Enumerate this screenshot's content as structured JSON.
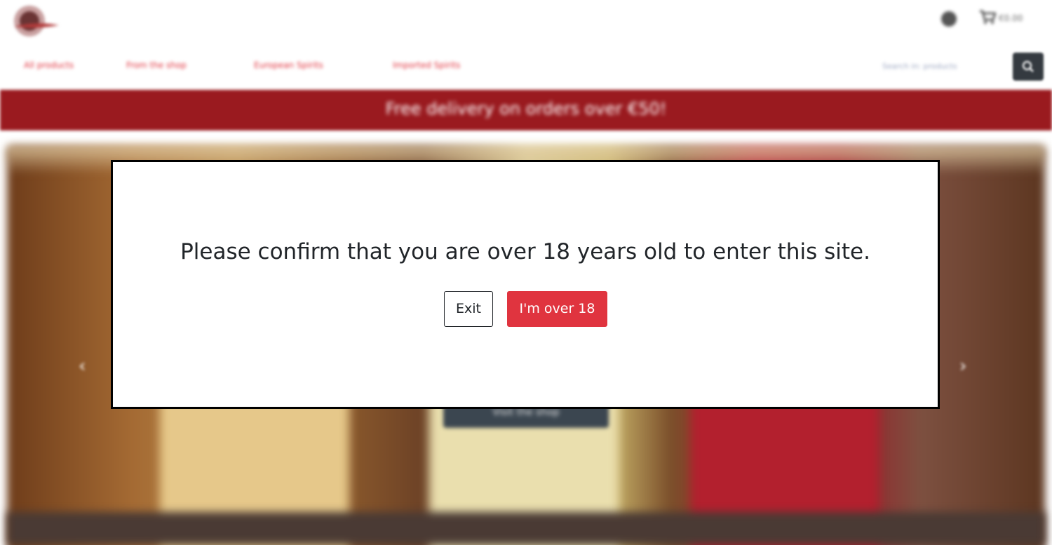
{
  "header": {
    "cart_total": "€0.00"
  },
  "nav": {
    "items": [
      "All products",
      "From the shop",
      "European Spirits",
      "Imported Spirits"
    ]
  },
  "search": {
    "category_select": "Search in: products"
  },
  "banner": {
    "text": "Free delivery on orders over €50!"
  },
  "hero": {
    "cta_label": "Visit the shop",
    "prev_arrow": "‹",
    "next_arrow": "›"
  },
  "modal": {
    "message": "Please confirm that you are over 18 years old to enter this site.",
    "exit_label": "Exit",
    "confirm_label": "I'm over 18"
  },
  "colors": {
    "accent": "#e0343f",
    "banner": "#9a1a1f",
    "dark": "#343a40"
  },
  "icons": [
    "logo",
    "account-icon",
    "cart-icon",
    "search-icon",
    "chevron-left-icon",
    "chevron-right-icon"
  ]
}
